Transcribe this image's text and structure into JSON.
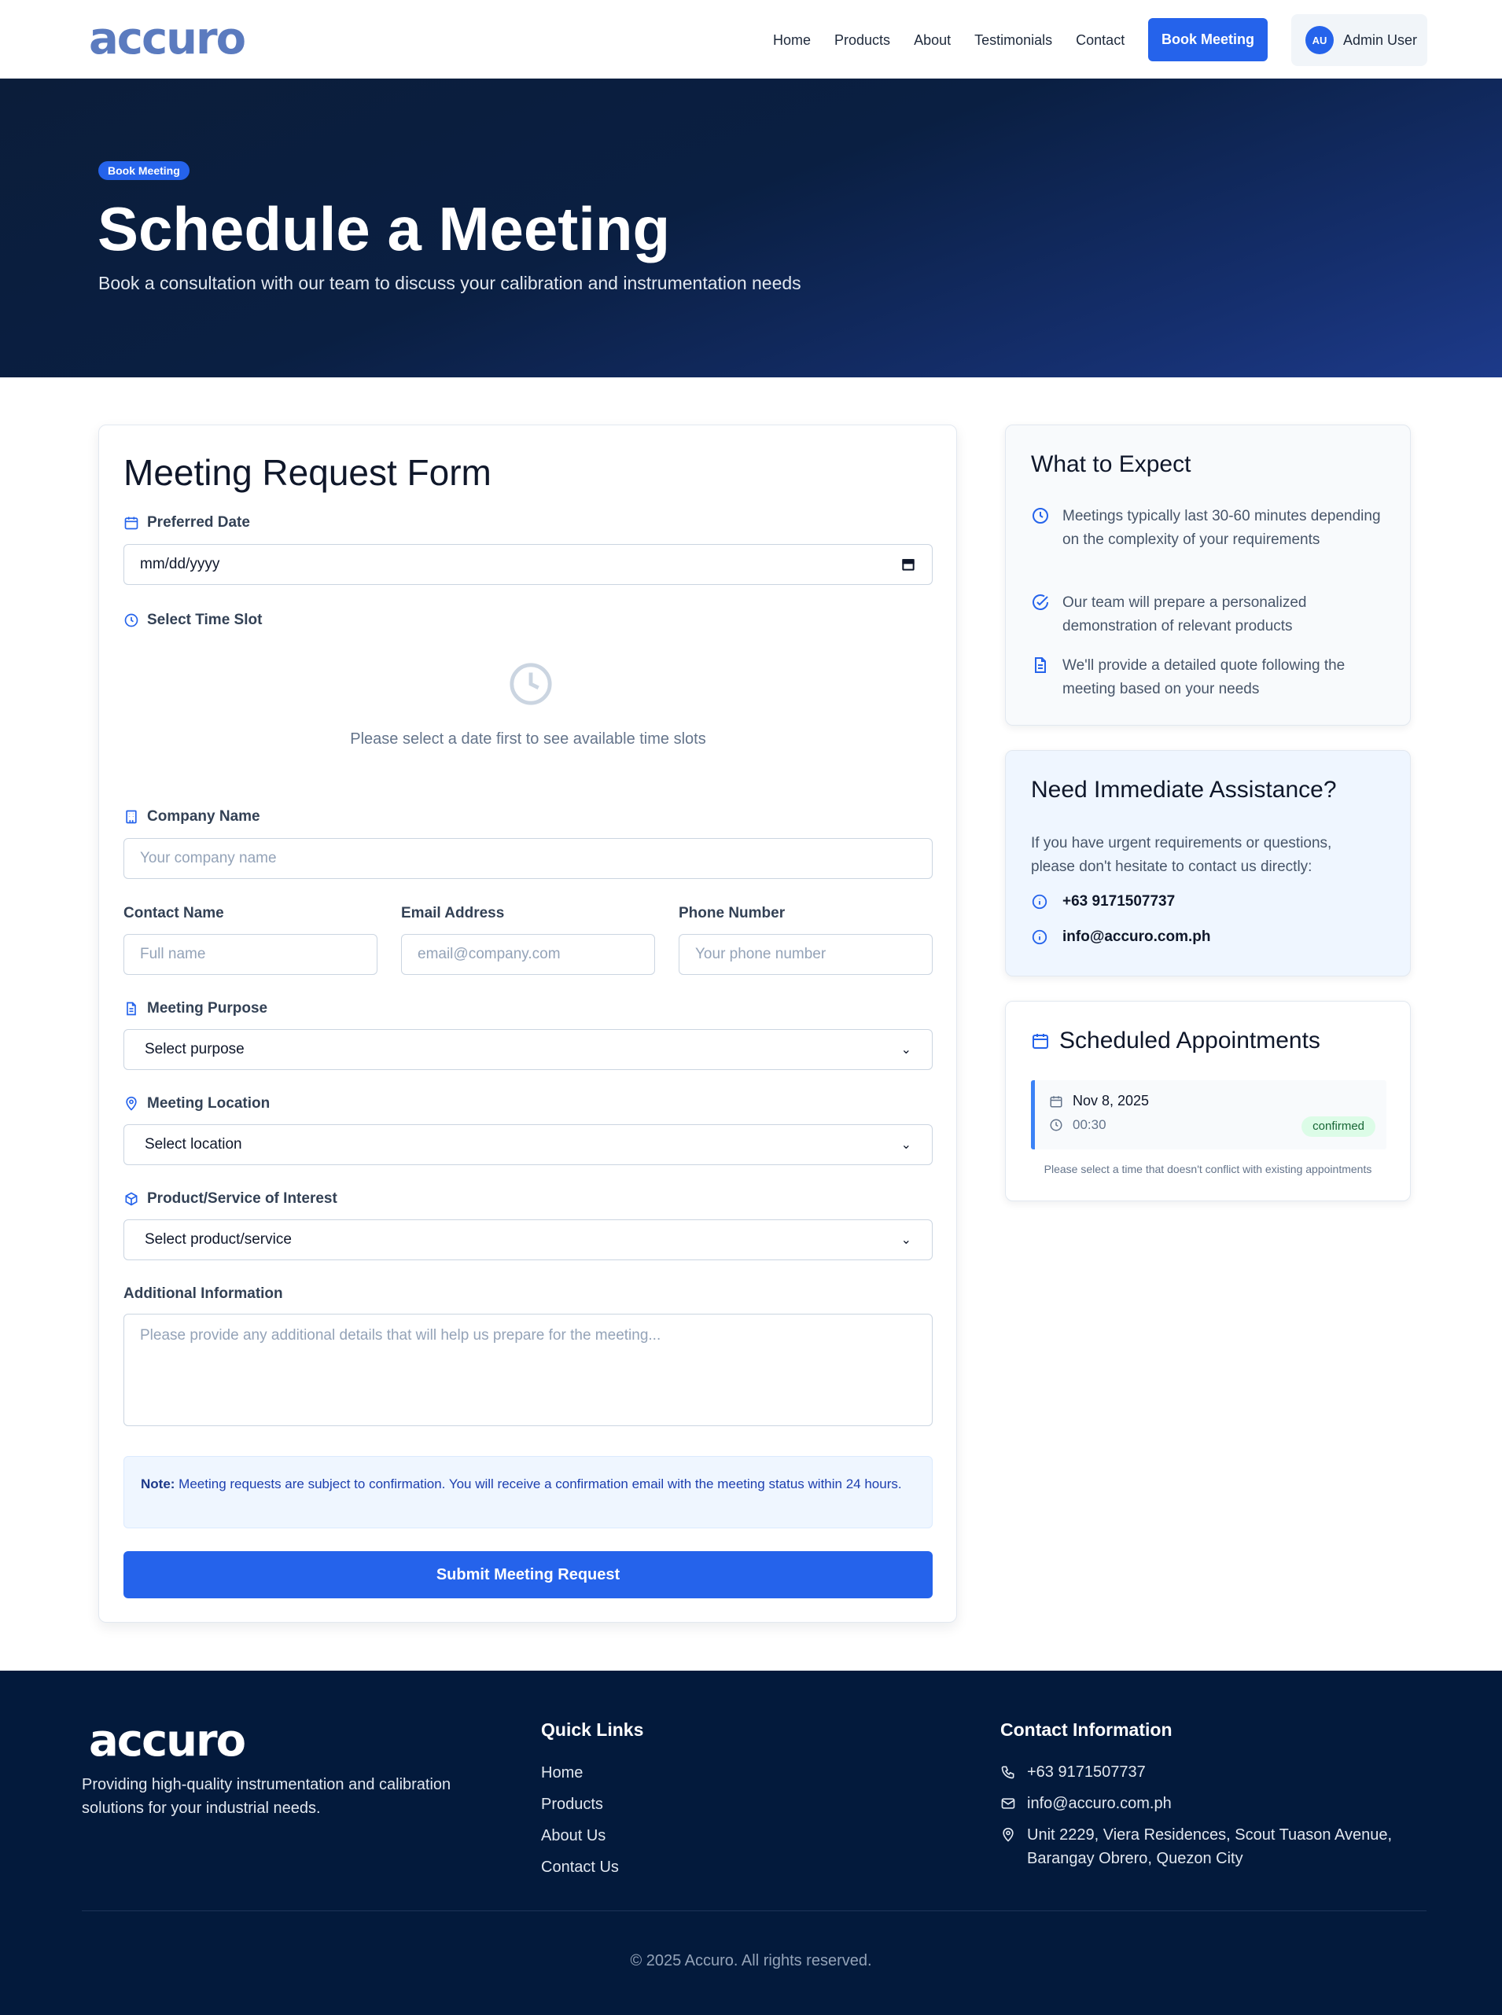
{
  "brand": {
    "logo_text": "accuro"
  },
  "nav": {
    "links": [
      "Home",
      "Products",
      "About",
      "Testimonials",
      "Contact"
    ],
    "book_label": "Book Meeting",
    "user_initials": "AU",
    "user_name": "Admin User"
  },
  "hero": {
    "badge": "Book Meeting",
    "title": "Schedule a Meeting",
    "subtitle": "Book a consultation with our team to discuss your calibration and instrumentation needs"
  },
  "form": {
    "title": "Meeting Request Form",
    "date_label": "Preferred Date",
    "date_placeholder": "mm/dd/yyyy",
    "time_label": "Select Time Slot",
    "time_empty": "Please select a date first to see available time slots",
    "company_label": "Company Name",
    "company_placeholder": "Your company name",
    "contact_label": "Contact Name",
    "contact_placeholder": "Full name",
    "email_label": "Email Address",
    "email_placeholder": "email@company.com",
    "phone_label": "Phone Number",
    "phone_placeholder": "Your phone number",
    "purpose_label": "Meeting Purpose",
    "purpose_value": "Select purpose",
    "location_label": "Meeting Location",
    "location_value": "Select location",
    "product_label": "Product/Service of Interest",
    "product_value": "Select product/service",
    "info_label": "Additional Information",
    "info_placeholder": "Please provide any additional details that will help us prepare for the meeting...",
    "note_bold": "Note:",
    "note_text": " Meeting requests are subject to confirmation. You will receive a confirmation email with the meeting status within 24 hours.",
    "submit_label": "Submit Meeting Request"
  },
  "expect": {
    "title": "What to Expect",
    "items": [
      "Meetings typically last 30-60 minutes depending on the complexity of your requirements",
      "Our team will prepare a personalized demonstration of relevant products",
      "We'll provide a detailed quote following the meeting based on your needs"
    ]
  },
  "assist": {
    "title": "Need Immediate Assistance?",
    "text": "If you have urgent requirements or questions, please don't hesitate to contact us directly:",
    "phone": "+63 9171507737",
    "email": "info@accuro.com.ph"
  },
  "appointments": {
    "title": "Scheduled Appointments",
    "items": [
      {
        "date": "Nov 8, 2025",
        "time": "00:30",
        "status": "confirmed"
      }
    ],
    "note": "Please select a time that doesn't conflict with existing appointments"
  },
  "footer": {
    "logo_text": "accuro",
    "description": "Providing high-quality instrumentation and calibration solutions for your industrial needs.",
    "quick_links_title": "Quick Links",
    "quick_links": [
      "Home",
      "Products",
      "About Us",
      "Contact Us"
    ],
    "contact_title": "Contact Information",
    "phone": "+63 9171507737",
    "email": "info@accuro.com.ph",
    "address": "Unit 2229, Viera Residences, Scout Tuason Avenue, Barangay Obrero, Quezon City",
    "copyright": "© 2025 Accuro. All rights reserved."
  },
  "colors": {
    "primary": "#2563eb",
    "hero_dark": "#0b1d3a",
    "footer_bg": "#031a3c",
    "status_green": "#dcfce7"
  }
}
